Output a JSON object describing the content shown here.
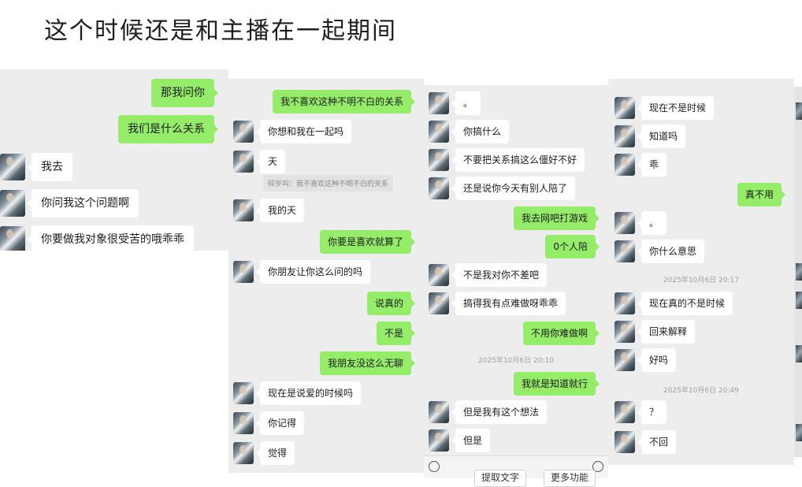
{
  "page_title": "这个时候还是和主播在一起期间",
  "panel1": {
    "messages": [
      {
        "side": "right",
        "text": "那我问你"
      },
      {
        "side": "right",
        "text": "我们是什么关系"
      },
      {
        "side": "left",
        "text": "我去"
      },
      {
        "side": "left",
        "text": "你问我这个问题啊"
      },
      {
        "side": "left",
        "text": "你要做我对象很受苦的哦乖乖"
      }
    ]
  },
  "panel2": {
    "messages": [
      {
        "side": "right",
        "text": "我不喜欢这种不明不白的关系"
      },
      {
        "side": "left",
        "text": "你想和我在一起吗"
      },
      {
        "side": "left",
        "text": "天"
      },
      {
        "side": "left",
        "text": "我的天"
      },
      {
        "side": "right",
        "text": "你要是喜欢就算了"
      },
      {
        "side": "left",
        "text": "你朋友让你这么问的吗"
      },
      {
        "side": "right",
        "text": "说真的"
      },
      {
        "side": "right",
        "text": "不是"
      },
      {
        "side": "right",
        "text": "我朋友没这么无聊"
      },
      {
        "side": "left",
        "text": "现在是说爱的时候吗"
      },
      {
        "side": "left",
        "text": "你记得"
      },
      {
        "side": "left",
        "text": "觉得"
      }
    ],
    "quote": "碎岁叫：我不喜欢这种不明不白的关系"
  },
  "panel3": {
    "messages": [
      {
        "side": "left",
        "text": "。"
      },
      {
        "side": "left",
        "text": "你搞什么"
      },
      {
        "side": "left",
        "text": "不要把关系搞这么僵好不好"
      },
      {
        "side": "left",
        "text": "还是说你今天有别人陪了"
      },
      {
        "side": "right",
        "text": "我去网吧打游戏"
      },
      {
        "side": "right",
        "text": "0个人陪"
      },
      {
        "side": "left",
        "text": "不是我对你不差吧"
      },
      {
        "side": "left",
        "text": "搞得我有点难做呀乖乖"
      },
      {
        "side": "right",
        "text": "不用你难做啊"
      },
      {
        "side": "right",
        "text": "我就是知道就行"
      },
      {
        "side": "left",
        "text": "但是我有这个想法"
      },
      {
        "side": "left",
        "text": "但是"
      }
    ],
    "timestamp": "2025年10月6日 20:10"
  },
  "panel4": {
    "messages": [
      {
        "side": "left",
        "text": "现在不是时候"
      },
      {
        "side": "left",
        "text": "知道吗"
      },
      {
        "side": "left",
        "text": "乖"
      },
      {
        "side": "right",
        "text": "真不用"
      },
      {
        "side": "left",
        "text": "。"
      },
      {
        "side": "left",
        "text": "你什么意思"
      },
      {
        "side": "left",
        "text": "现在真的不是时候"
      },
      {
        "side": "left",
        "text": "回来解释"
      },
      {
        "side": "left",
        "text": "好吗"
      },
      {
        "side": "left",
        "text": "？"
      },
      {
        "side": "left",
        "text": "不回"
      }
    ],
    "timestamps": [
      "2025年10月6日 20:17",
      "2025年10月6日 20:49"
    ]
  },
  "bottom": {
    "extract_text": "提取文字",
    "more_functions": "更多功能"
  },
  "colors": {
    "panel_bg": "#ededed",
    "bubble_green": "#95ec69",
    "bubble_white": "#ffffff"
  }
}
